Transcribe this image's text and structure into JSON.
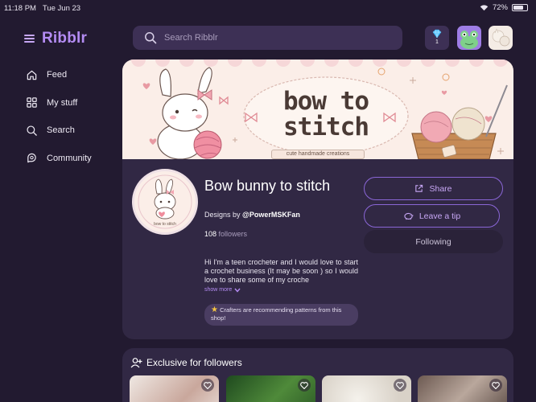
{
  "status_bar": {
    "time": "11:18 PM",
    "date": "Tue Jun 23",
    "battery": "72%",
    "battery_level": 0.72
  },
  "app": {
    "name": "Ribblr"
  },
  "nav": [
    {
      "label": "Feed",
      "icon": "home-icon"
    },
    {
      "label": "My stuff",
      "icon": "grid-icon"
    },
    {
      "label": "Search",
      "icon": "search-icon"
    },
    {
      "label": "Community",
      "icon": "community-icon"
    }
  ],
  "search": {
    "placeholder": "Search Ribblr"
  },
  "header": {
    "gem_count": "1"
  },
  "banner": {
    "title": "bow to stitch",
    "subtitle": "cute handmade creations"
  },
  "shop": {
    "avatar_text": "bow to stitch",
    "name": "Bow bunny to stitch",
    "designs_by_prefix": "Designs by",
    "designer": "@PowerMSKFan",
    "followers_count": "108",
    "followers_label": "followers",
    "description": "Hi I'm a teen crocheter and I would love to start a crochet business (It may be soon ) so I would love to share some of my croche",
    "show_more": "show more",
    "recommend_badge": "Crafters are recommending patterns from this shop!"
  },
  "actions": {
    "share": "Share",
    "tip": "Leave a tip",
    "following": "Following"
  },
  "exclusive": {
    "title": "Exclusive for followers"
  },
  "colors": {
    "background": "#221a30",
    "card": "#312844",
    "accent": "#b48cf3",
    "search_bg": "#3d3055"
  }
}
